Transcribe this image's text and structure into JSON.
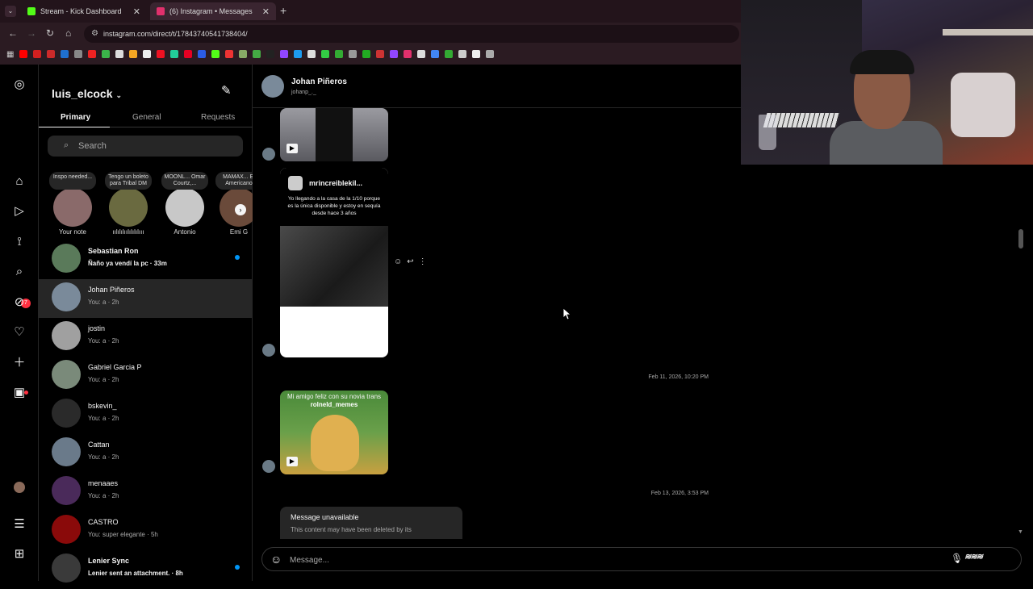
{
  "browser": {
    "tabs": [
      {
        "title": "Stream - Kick Dashboard",
        "favicon_color": "#53fc18"
      },
      {
        "title": "(6) Instagram • Messages",
        "favicon_color": "#e1306c"
      }
    ],
    "new_tab_label": "+",
    "url": "instagram.com/direct/t/17843740541738404/"
  },
  "inbox": {
    "username": "luis_elcock",
    "tabs": [
      "Primary",
      "General",
      "Requests"
    ],
    "search_placeholder": "Search",
    "notes": [
      {
        "bubble": "Inspo needed...",
        "name": "Your note",
        "color": "#8a6a6a"
      },
      {
        "bubble": "Tengo un boleto para Tribal DM",
        "name": "ıılılılıılılılılııı",
        "color": "#6a6a40"
      },
      {
        "bubble": "MOONL... Omar Courtz,...",
        "name": "Antonio",
        "color": "#c8c8c8"
      },
      {
        "bubble": "MAMAX... El Americano",
        "name": "Emi G",
        "color": "#6a4a3a"
      }
    ],
    "conversations": [
      {
        "name": "Sebastian Ron",
        "preview": "Ñaño ya vendí la pc · 33m",
        "unread": true,
        "color": "#5a7a5a"
      },
      {
        "name": "Johan Piñeros",
        "preview": "You: a · 2h",
        "unread": false,
        "color": "#7a8a9a"
      },
      {
        "name": "jostin",
        "preview": "You: a · 2h",
        "unread": false,
        "color": "#a0a0a0"
      },
      {
        "name": "Gabriel Garcia P",
        "preview": "You: a · 2h",
        "unread": false,
        "color": "#7a8a7a"
      },
      {
        "name": "bskevin_",
        "preview": "You: a · 2h",
        "unread": false,
        "color": "#2a2a2a"
      },
      {
        "name": "Cattan",
        "preview": "You: a · 2h",
        "unread": false,
        "color": "#6a7a8a"
      },
      {
        "name": "menaaes",
        "preview": "You: a · 2h",
        "unread": false,
        "color": "#4a2a5a"
      },
      {
        "name": "CASTRO",
        "preview": "You: super elegante · 5h",
        "unread": false,
        "color": "#8a0a0a"
      },
      {
        "name": "Lenier Sync",
        "preview": "Lenier sent an attachment. · 8h",
        "unread": true,
        "color": "#3a3a3a"
      }
    ]
  },
  "rail": {
    "badge_count": "7"
  },
  "chat": {
    "name": "Johan Piñeros",
    "handle": "johanp_._",
    "reel": {
      "user": "mrincreiblekil...",
      "caption": "Yo llegando a la casa de la 1/10 porque es la única disponible y estoy en sequía desde hace 3 años"
    },
    "timestamp1": "Feb 11, 2026, 10:20 PM",
    "meme_caption": "Mi amigo feliz con su novia trans",
    "meme_watermark": "rolneld_memes",
    "timestamp2": "Feb 13, 2026, 3:53 PM",
    "unavailable_title": "Message unavailable",
    "unavailable_text": "This content may have been deleted by its",
    "composer_placeholder": "Message..."
  }
}
